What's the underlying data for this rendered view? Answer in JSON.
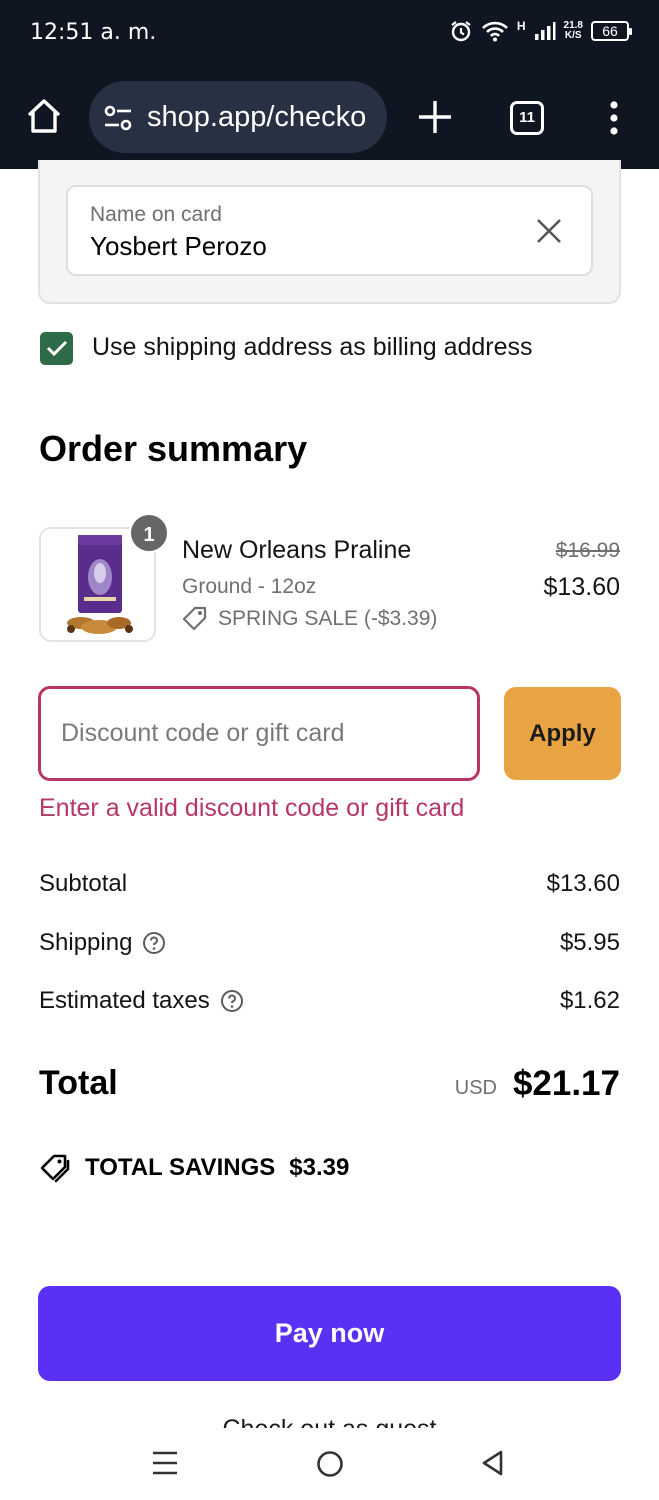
{
  "status_bar": {
    "time": "12:51 a. m.",
    "network_type": "H",
    "speed_value": "21.8",
    "speed_unit": "K/S",
    "battery": "66"
  },
  "browser": {
    "url": "shop.app/checko",
    "tab_count": "11"
  },
  "payment": {
    "name_label": "Name on card",
    "name_value": "Yosbert Perozo",
    "billing_checkbox_label": "Use shipping address as billing address",
    "billing_checked": true
  },
  "order_summary": {
    "title": "Order summary",
    "item": {
      "quantity": "1",
      "name": "New Orleans Praline",
      "variant": "Ground - 12oz",
      "discount": "SPRING SALE (-$3.39)",
      "original_price": "$16.99",
      "price": "$13.60"
    },
    "discount": {
      "placeholder": "Discount code or gift card",
      "value": "",
      "apply_label": "Apply",
      "error": "Enter a valid discount code or gift card"
    },
    "lines": {
      "subtotal_label": "Subtotal",
      "subtotal_value": "$13.60",
      "shipping_label": "Shipping",
      "shipping_value": "$5.95",
      "taxes_label": "Estimated taxes",
      "taxes_value": "$1.62"
    },
    "total": {
      "label": "Total",
      "currency": "USD",
      "value": "$21.17"
    },
    "savings": {
      "label": "TOTAL SAVINGS",
      "value": "$3.39"
    }
  },
  "actions": {
    "pay_label": "Pay now",
    "guest_label": "Check out as guest"
  },
  "colors": {
    "accent": "#5a31f4",
    "apply": "#e8a443",
    "error": "#b63766",
    "checkbox": "#2e6b49"
  }
}
